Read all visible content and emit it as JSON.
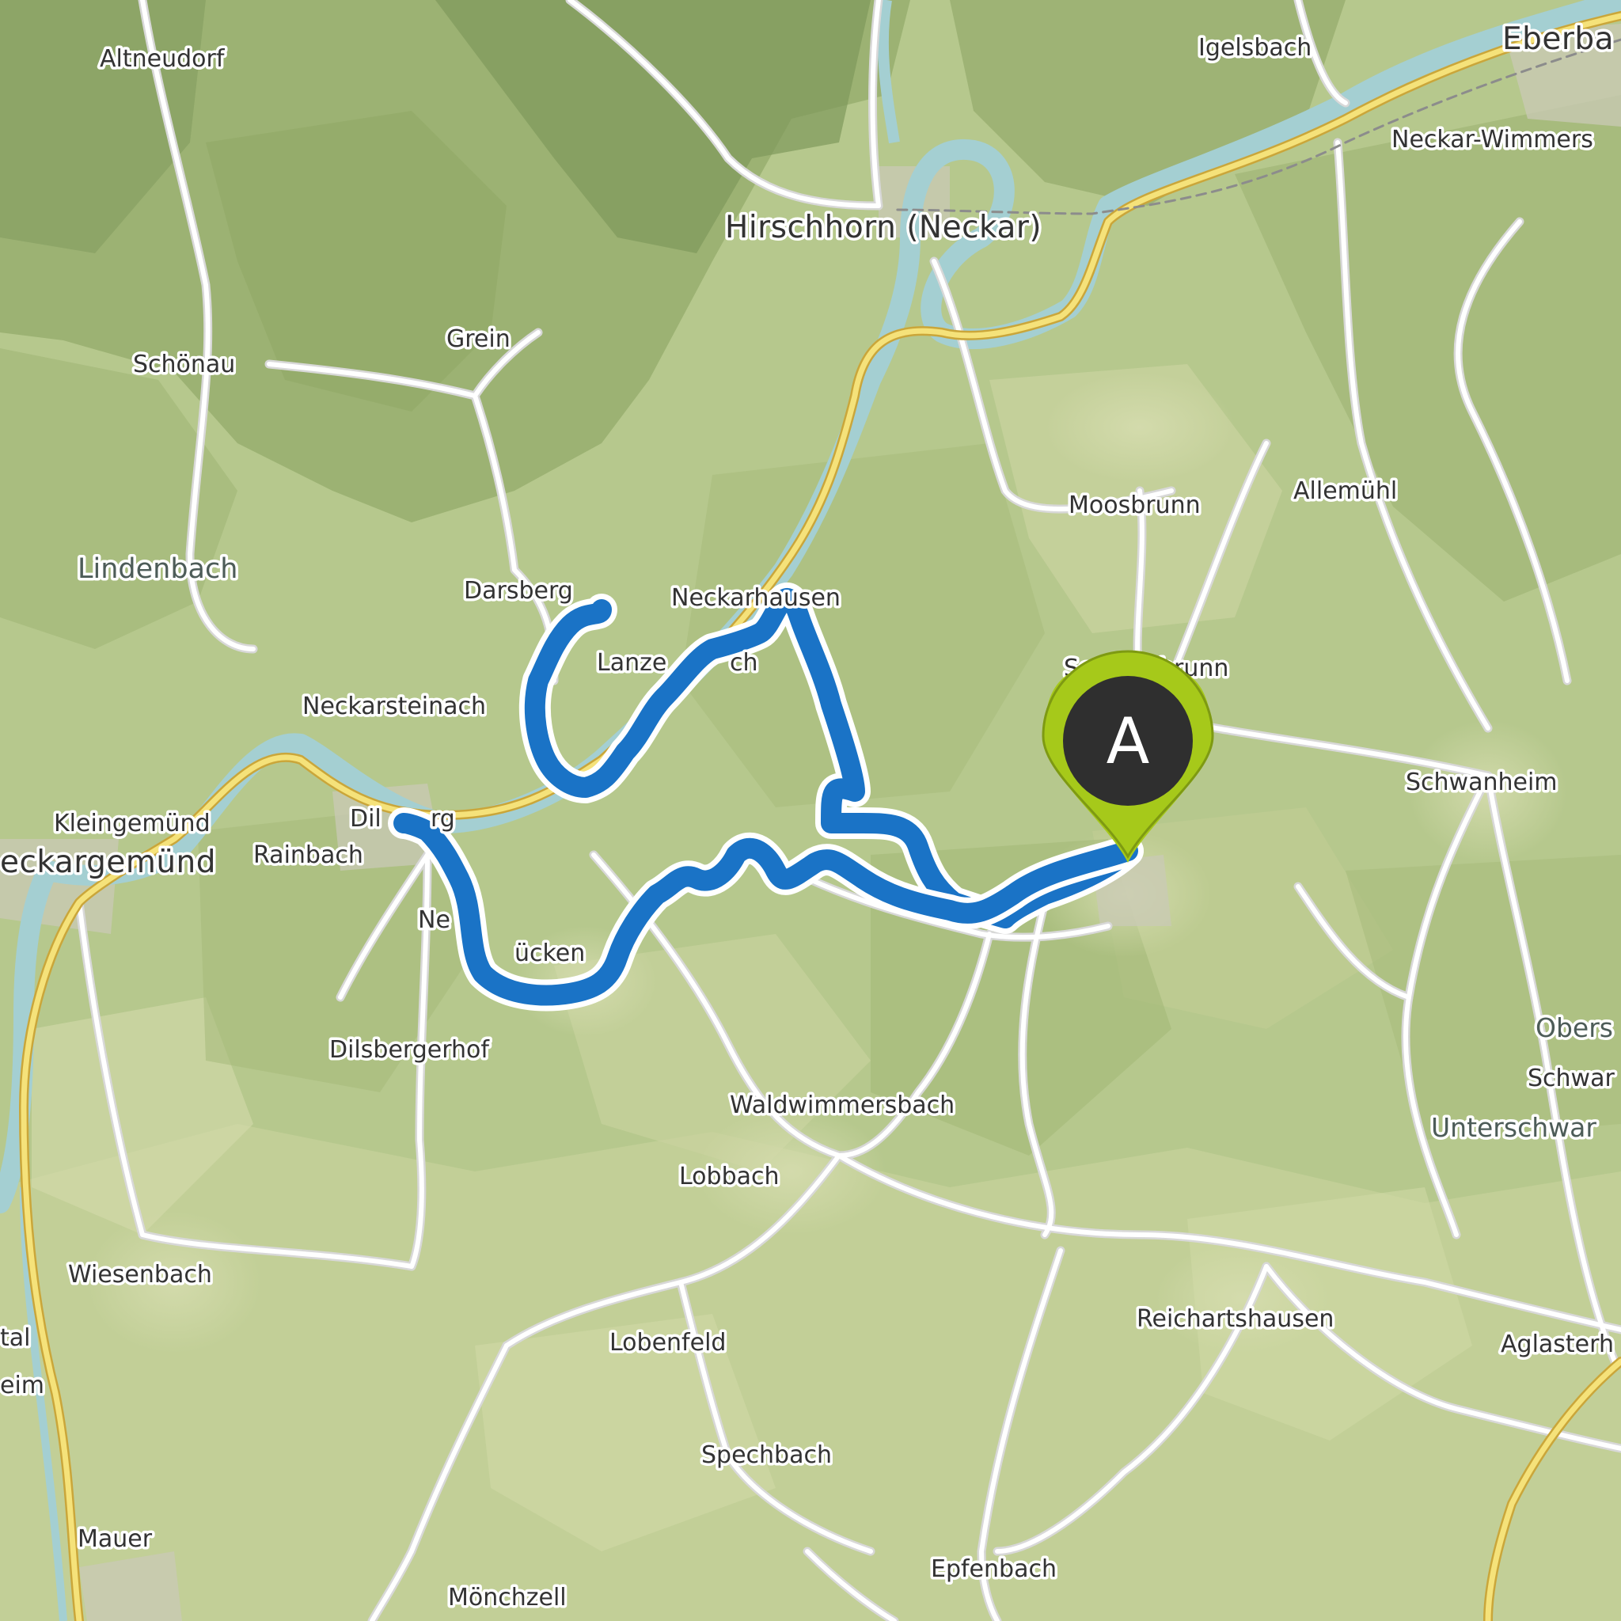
{
  "map": {
    "route_color": "#1a73c6",
    "marker": {
      "label": "A",
      "pin_color": "#a6c91a",
      "inner_color": "#2f2f2f",
      "icon": "map-pin-icon"
    },
    "place_labels": {
      "altneudorf": "Altneudorf",
      "igelsbach": "Igelsbach",
      "eberbach": "Eberba",
      "neckar_wimmersbach": "Neckar-Wimmers",
      "hirschhorn": "Hirschhorn (Neckar)",
      "grein": "Grein",
      "schoenau": "Schönau",
      "moosbrunn": "Moosbrunn",
      "allemuehl": "Allemühl",
      "lindenbach": "Lindenbach",
      "darsberg": "Darsberg",
      "neckarhausen": "Neckarhausen",
      "lanzenbach": "Lanze",
      "lanzenbach_end": "ch",
      "schoenbrunn": "Sc",
      "schoenbrunn_end": "brunn",
      "neckarsteinach": "Neckarsteinach",
      "schwanheim": "Schwanheim",
      "kleingemuend": "Kleingemünd",
      "dilsberg": "Dil",
      "dilsberg_end": "rg",
      "neckargemuend": "eckargemünd",
      "rainbach": "Rainbach",
      "neckarhausen_sw": "Ne",
      "mueckenloch": "ücken",
      "obers": "Obers",
      "schwar": "Schwar",
      "unterschwar": "Unterschwar",
      "dilsbergerhof": "Dilsbergerhof",
      "waldwimmersbach": "Waldwimmersbach",
      "lobbach": "Lobbach",
      "wiesenbach": "Wiesenbach",
      "reichartshausen": "Reichartshausen",
      "lobenfeld": "Lobenfeld",
      "aglasterhausen": "Aglasterh",
      "tal": "tal",
      "eim": "eim",
      "spechbach": "Spechbach",
      "mauer": "Mauer",
      "epfenbach": "Epfenbach",
      "moenchzell": "Mönchzell"
    }
  }
}
